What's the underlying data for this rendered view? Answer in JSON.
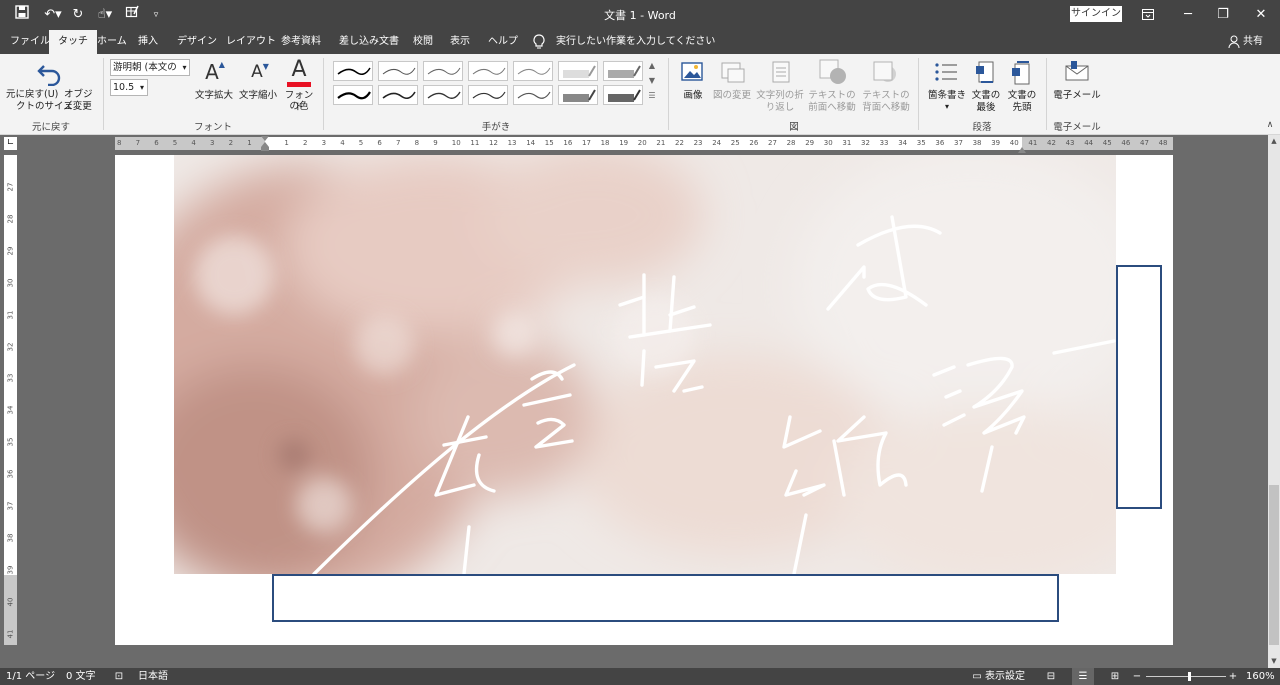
{
  "window": {
    "title": "文書 1  -  Word",
    "signin_label": "サインイン"
  },
  "tabs": [
    {
      "label": "ファイル"
    },
    {
      "label": "タッチ"
    },
    {
      "label": "ホーム"
    },
    {
      "label": "挿入"
    },
    {
      "label": "デザイン"
    },
    {
      "label": "レイアウト"
    },
    {
      "label": "参考資料"
    },
    {
      "label": "差し込み文書"
    },
    {
      "label": "校閲"
    },
    {
      "label": "表示"
    },
    {
      "label": "ヘルプ"
    }
  ],
  "active_tab": "タッチ",
  "tellme": "実行したい作業を入力してください",
  "share_label": "共有",
  "ribbon": {
    "undo": {
      "label": "元に戻す(U)"
    },
    "object_resize": {
      "label1": "オブジェ",
      "label2": "クトのサイズ変更"
    },
    "group_undo": "元に戻す",
    "font_name": "游明朝 (本文の",
    "font_size": "10.5",
    "grow_font": "文字拡大",
    "shrink_font": "文字縮小",
    "font_color": {
      "label1": "フォント",
      "label2": "の色"
    },
    "group_font": "フォント",
    "group_ink": "手がき",
    "picture": "画像",
    "change_picture": "図の変更",
    "wrap_text": {
      "label1": "文字列の折",
      "label2": "り返し"
    },
    "bring_forward": {
      "label1": "テキストの",
      "label2": "前面へ移動"
    },
    "send_backward": {
      "label1": "テキストの",
      "label2": "背面へ移動"
    },
    "group_picture": "図",
    "bullets": "箇条書き",
    "doc_end": {
      "label1": "文書の",
      "label2": "最後"
    },
    "doc_start": {
      "label1": "文書の",
      "label2": "先頭"
    },
    "group_paragraph": "段落",
    "email": "電子メール",
    "group_email": "電子メール"
  },
  "ruler": {
    "h_ticks": [
      "8",
      "7",
      "6",
      "5",
      "4",
      "3",
      "2",
      "1",
      "",
      "1",
      "2",
      "3",
      "4",
      "5",
      "6",
      "7",
      "8",
      "9",
      "10",
      "11",
      "12",
      "13",
      "14",
      "15",
      "16",
      "17",
      "18",
      "19",
      "20",
      "21",
      "22",
      "23",
      "24",
      "25",
      "26",
      "27",
      "28",
      "29",
      "30",
      "31",
      "32",
      "33",
      "34",
      "35",
      "36",
      "37",
      "38",
      "39",
      "40",
      "41",
      "42",
      "43",
      "44",
      "45",
      "46",
      "47",
      "48"
    ],
    "v_ticks": [
      "27",
      "28",
      "29",
      "30",
      "31",
      "32",
      "33",
      "34",
      "35",
      "36",
      "37",
      "38",
      "39",
      "40",
      "41"
    ]
  },
  "status": {
    "page": "1/1 ページ",
    "words": "0 文字",
    "language": "日本語",
    "display_settings": "表示設定",
    "zoom": "160%"
  },
  "colors": {
    "titlebar": "#444444",
    "ribbon": "#f3f3f3",
    "accent_blue": "#2b579a",
    "textbox_border": "#2b4c7e",
    "font_color_red": "#e81123"
  }
}
